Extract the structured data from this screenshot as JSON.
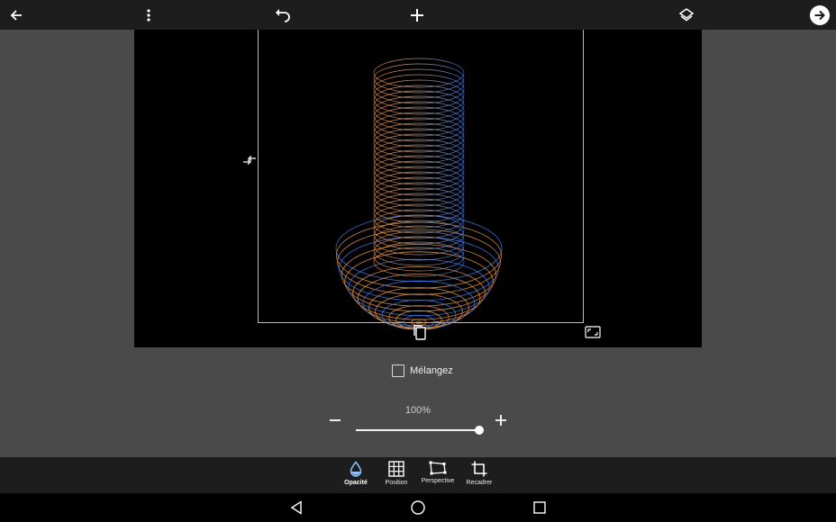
{
  "colors": {
    "toolbar_bg": "#1d1d1d",
    "canvas_bg": "#000000",
    "panel_bg": "#4a4a4a",
    "active_tool": "#8fc3ff",
    "artwork_left": "#f08a3c",
    "artwork_right": "#3c78e6"
  },
  "topbar": {
    "icons": [
      "arrow-left-icon",
      "more-vertical-icon",
      "undo-icon",
      "plus-icon",
      "layers-icon",
      "arrow-right-circle-icon"
    ]
  },
  "controls": {
    "blend_label": "Mélangez",
    "blend_checked": false,
    "opacity_label": "100%",
    "opacity_value": 1.0,
    "minus_label": "−",
    "plus_label": "+"
  },
  "tools": [
    {
      "label": "Opacité",
      "icon": "opacity-drop-icon",
      "active": true
    },
    {
      "label": "Position",
      "icon": "grid-icon",
      "active": false
    },
    {
      "label": "Perspective",
      "icon": "perspective-icon",
      "active": false
    },
    {
      "label": "Recadrer",
      "icon": "crop-icon",
      "active": false
    }
  ],
  "navbar": {
    "icons": [
      "back-triangle-icon",
      "home-circle-icon",
      "recents-square-icon"
    ]
  }
}
